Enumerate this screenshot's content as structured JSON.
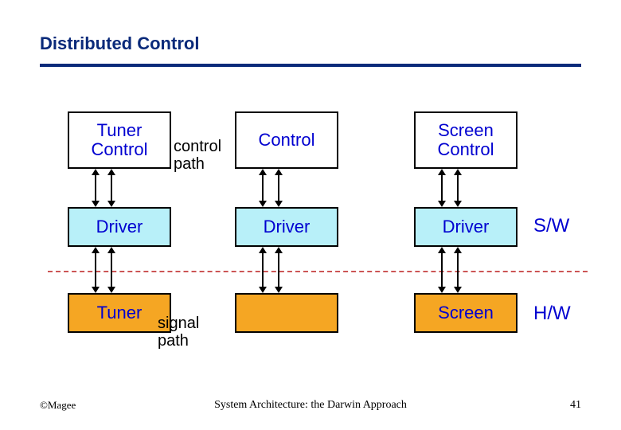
{
  "title": "Distributed Control",
  "boxes": {
    "tuner_control": "Tuner Control",
    "middle_control": "Control",
    "screen_control": "Screen Control",
    "driver1": "Driver",
    "driver2": "Driver",
    "driver3": "Driver",
    "tuner_hw": "Tuner",
    "middle_hw": "",
    "screen_hw": "Screen"
  },
  "labels": {
    "control_path": "control path",
    "signal_path": "signal path",
    "sw": "S/W",
    "hw": "H/W"
  },
  "footer": {
    "left": "©Magee",
    "center": "System Architecture: the Darwin Approach",
    "right": "41"
  },
  "colors": {
    "title": "#0a2a7a",
    "box_text": "#0000d0",
    "driver_fill": "#b8f0f9",
    "hw_fill": "#f5a623",
    "dash": "#cc5555"
  }
}
